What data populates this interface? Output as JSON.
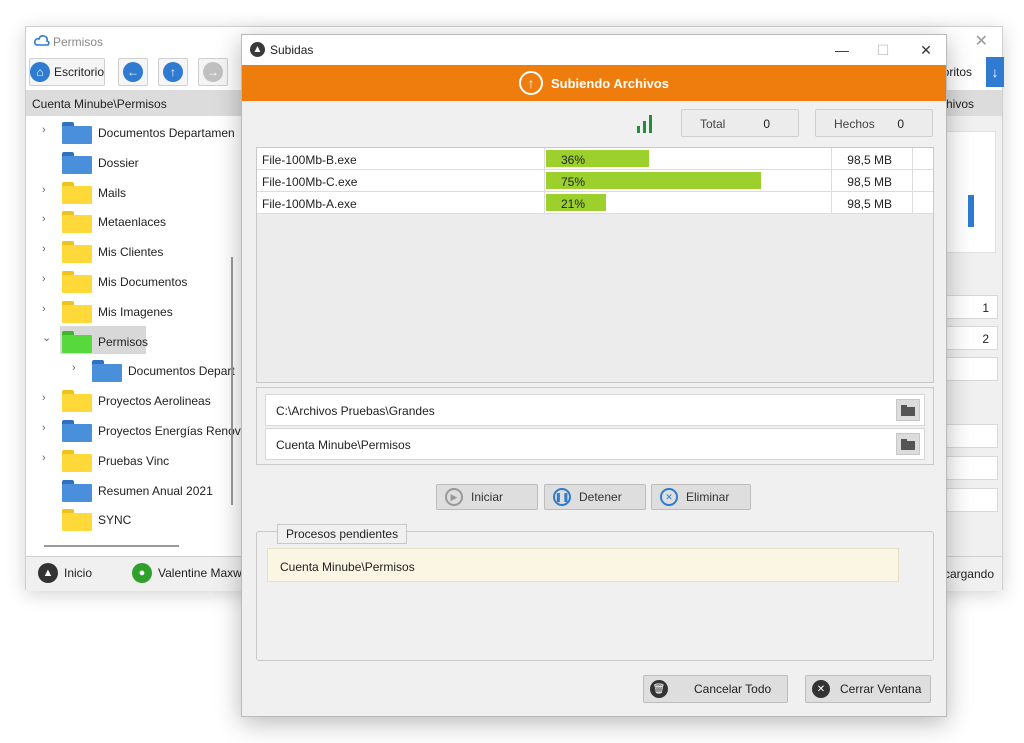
{
  "background_window": {
    "title": "Permisos",
    "close_glyph": "✕",
    "toolbar": {
      "desktop_label": "Escritorio",
      "right_fragment": "oritos"
    },
    "path": "Cuenta Minube\\Permisos",
    "path_right_fragment": "chivos",
    "tree": [
      {
        "label": "Documentos Departamen",
        "color": "blue",
        "expandable": true
      },
      {
        "label": "Dossier",
        "color": "blue",
        "expandable": false
      },
      {
        "label": "Mails",
        "color": "yellow",
        "expandable": true
      },
      {
        "label": "Metaenlaces",
        "color": "yellow",
        "expandable": true
      },
      {
        "label": "Mis Clientes",
        "color": "yellow",
        "expandable": true
      },
      {
        "label": "Mis Documentos",
        "color": "yellow",
        "expandable": true
      },
      {
        "label": "Mis Imagenes",
        "color": "yellow",
        "expandable": true
      },
      {
        "label": "Permisos",
        "color": "green",
        "expandable": true,
        "selected": true
      },
      {
        "label": "Documentos Depart",
        "color": "blue",
        "expandable": true
      },
      {
        "label": "Proyectos Aerolineas",
        "color": "yellow",
        "expandable": true
      },
      {
        "label": "Proyectos Energías Renov",
        "color": "blue",
        "expandable": true
      },
      {
        "label": "Pruebas Vinc",
        "color": "yellow",
        "expandable": true
      },
      {
        "label": "Resumen Anual 2021",
        "color": "blue",
        "expandable": false
      },
      {
        "label": "SYNC",
        "color": "yellow",
        "expandable": false
      }
    ],
    "right_numbers": [
      "1",
      "2"
    ],
    "status": {
      "home_label": "Inicio",
      "user_label": "Valentine Maxwe",
      "right_fragment": "cargando"
    }
  },
  "dialog": {
    "title": "Subidas",
    "window_controls": {
      "minimize": "—",
      "maximize": "☐",
      "close": "✕"
    },
    "banner_text": "Subiendo Archivos",
    "counters": {
      "total_label": "Total",
      "total_value": "0",
      "done_label": "Hechos",
      "done_value": "0"
    },
    "files": [
      {
        "name": "File-100Mb-B.exe",
        "progress": 36,
        "progress_label": "36%",
        "size": "98,5 MB"
      },
      {
        "name": "File-100Mb-C.exe",
        "progress": 75,
        "progress_label": "75%",
        "size": "98,5 MB"
      },
      {
        "name": "File-100Mb-A.exe",
        "progress": 21,
        "progress_label": "21%",
        "size": "98,5 MB"
      }
    ],
    "source_path": "C:\\Archivos Pruebas\\Grandes",
    "dest_path": "Cuenta Minube\\Permisos",
    "buttons": {
      "start": "Iniciar",
      "stop": "Detener",
      "remove": "Eliminar",
      "cancel_all": "Cancelar Todo",
      "close_window": "Cerrar Ventana"
    },
    "pending": {
      "legend": "Procesos pendientes",
      "items": [
        "Cuenta Minube\\Permisos"
      ]
    },
    "colors": {
      "banner": "#ee7d0e",
      "progress": "#9cd02c",
      "accent_blue": "#2f7bd1",
      "signal": "#1e8f3a"
    }
  }
}
